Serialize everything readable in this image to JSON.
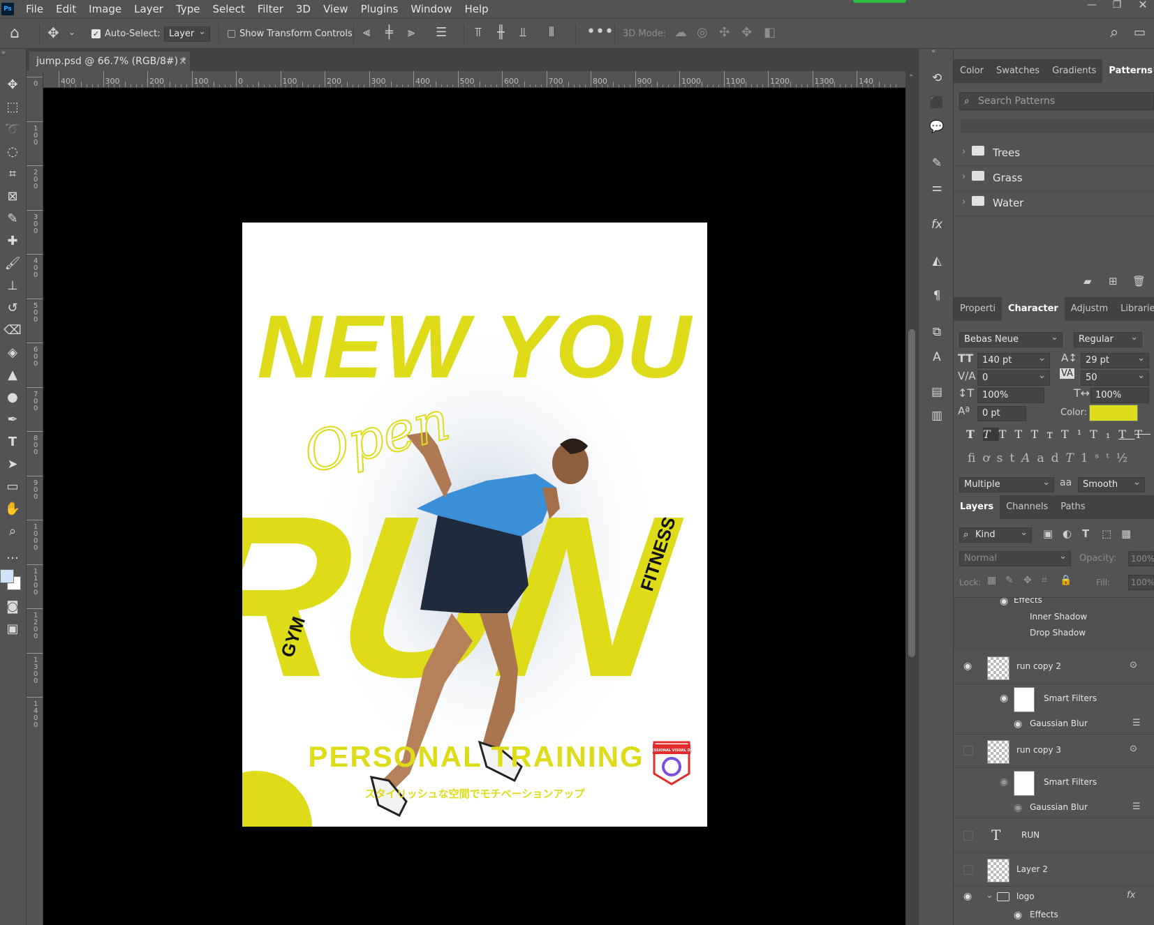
{
  "menu": {
    "app_badge": "Ps",
    "items": [
      "File",
      "Edit",
      "Image",
      "Layer",
      "Type",
      "Select",
      "Filter",
      "3D",
      "View",
      "Plugins",
      "Window",
      "Help"
    ]
  },
  "options": {
    "auto_select_label": "Auto-Select:",
    "auto_select_checked": true,
    "layer_select_value": "Layer",
    "show_transform_label": "Show Transform Controls",
    "mode_3d_label": "3D Mode:"
  },
  "document": {
    "tab_title": "jump.psd @ 66.7% (RGB/8#) *",
    "ruler_h": [
      "400",
      "300",
      "200",
      "100",
      "0",
      "100",
      "200",
      "300",
      "400",
      "500",
      "600",
      "700",
      "800",
      "900",
      "1000",
      "1100",
      "1200",
      "1300",
      "140"
    ],
    "ruler_v": [
      "0",
      "1 0 0",
      "2 0 0",
      "3 0 0",
      "4 0 0",
      "5 0 0",
      "6 0 0",
      "7 0 0",
      "8 0 0",
      "9 0 0",
      "1 0 0 0",
      "1 1 0 0",
      "1 2 0 0",
      "1 3 0 0",
      "1 4 0 0"
    ]
  },
  "poster": {
    "headline": "NEW YOU",
    "script_word": "Open",
    "big_word": "RUN",
    "side_left": "GYM",
    "side_right": "FITNESS",
    "subtitle": "PERSONAL TRAINING",
    "tagline_jp": "スタイリッシュな空間でモチベーションアップ",
    "badge_text": "PROFESSIONAL VISUAL DESIGN",
    "accent_color": "#dedb19"
  },
  "patterns_panel": {
    "tabs": [
      "Color",
      "Swatches",
      "Gradients",
      "Patterns"
    ],
    "active_tab": "Patterns",
    "search_placeholder": "Search Patterns",
    "groups": [
      "Trees",
      "Grass",
      "Water"
    ]
  },
  "character_panel": {
    "tabs": [
      "Properti",
      "Character",
      "Adjustm",
      "Libraries"
    ],
    "active_tab": "Character",
    "font_family": "Bebas Neue",
    "font_style": "Regular",
    "font_size": "140 pt",
    "leading": "29 pt",
    "kerning": "0",
    "tracking": "50",
    "vertical_scale": "100%",
    "horizontal_scale": "100%",
    "baseline_shift": "0 pt",
    "color_label": "Color:",
    "color_value": "#dedb19",
    "language": "Multiple",
    "antialias_label": "aa",
    "antialias": "Smooth"
  },
  "layers_panel": {
    "tabs": [
      "Layers",
      "Channels",
      "Paths"
    ],
    "active_tab": "Layers",
    "filter_label": "Kind",
    "blend_mode": "Normal",
    "opacity_label": "Opacity:",
    "opacity": "100%",
    "lock_label": "Lock:",
    "fill_label": "Fill:",
    "fill": "100%",
    "rows": [
      {
        "name": "Effects"
      },
      {
        "name": "Inner Shadow"
      },
      {
        "name": "Drop Shadow"
      },
      {
        "name": "run copy 2"
      },
      {
        "name": "Smart Filters"
      },
      {
        "name": "Gaussian Blur"
      },
      {
        "name": "run copy 3"
      },
      {
        "name": "Smart Filters"
      },
      {
        "name": "Gaussian Blur"
      },
      {
        "name": "RUN"
      },
      {
        "name": "Layer 2"
      },
      {
        "name": "logo"
      },
      {
        "name": "Effects"
      }
    ]
  }
}
